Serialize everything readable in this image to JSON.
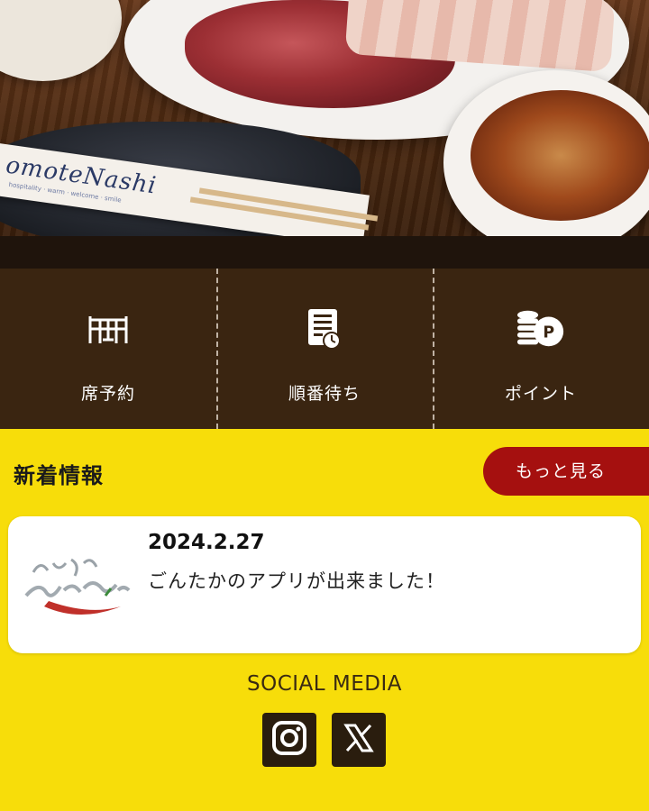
{
  "hero": {
    "chopstick_brand": "omoteNashi",
    "chopstick_tagline": "hospitality · warm · welcome · smile"
  },
  "nav": {
    "items": [
      {
        "label": "席予約",
        "icon": "table-icon"
      },
      {
        "label": "順番待ち",
        "icon": "queue-list-icon"
      },
      {
        "label": "ポイント",
        "icon": "points-coins-icon"
      }
    ]
  },
  "news": {
    "title": "新着情報",
    "more_label": "もっと見る",
    "items": [
      {
        "date": "2024.2.27",
        "text": "ごんたかのアプリが出来ました！",
        "thumb_icon": "restaurant-logo"
      }
    ]
  },
  "social": {
    "title": "SOCIAL MEDIA",
    "links": [
      {
        "name": "Instagram",
        "icon": "instagram-icon"
      },
      {
        "name": "X",
        "icon": "x-icon"
      }
    ]
  },
  "colors": {
    "background": "#f7dd0a",
    "nav_background": "#3a2511",
    "accent_red": "#a5100f",
    "social_button": "#2a1d0e"
  }
}
